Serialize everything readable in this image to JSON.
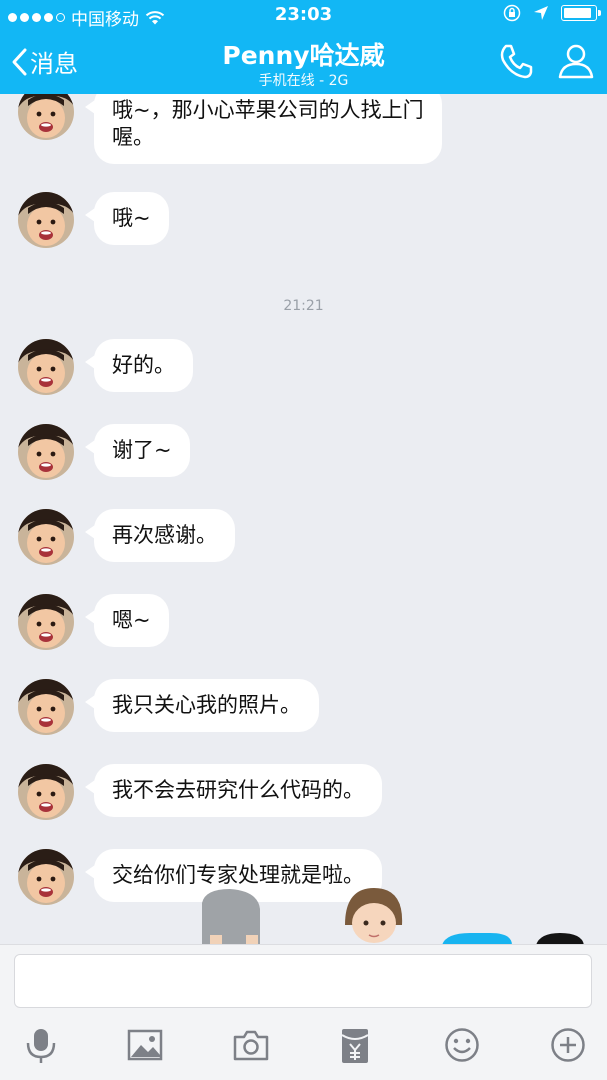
{
  "status_bar": {
    "carrier": "中国移动",
    "time": "23:03",
    "signal_dots": 4,
    "battery_level": 0.9
  },
  "nav": {
    "back_label": "消息",
    "title": "Penny哈达威",
    "subtitle": "手机在线 - 2G",
    "phone_icon": "phone-icon",
    "profile_icon": "person-icon"
  },
  "conversation": {
    "timestamp": "21:21",
    "messages": [
      {
        "lines": [
          "哦~，那小心苹果公司的人找上门",
          "喔。"
        ]
      },
      {
        "lines": [
          "哦~"
        ]
      },
      {
        "lines": [
          "好的。"
        ]
      },
      {
        "lines": [
          "谢了~"
        ]
      },
      {
        "lines": [
          "再次感谢。"
        ]
      },
      {
        "lines": [
          "嗯~"
        ]
      },
      {
        "lines": [
          "我只关心我的照片。"
        ]
      },
      {
        "lines": [
          "我不会去研究什么代码的。"
        ]
      },
      {
        "lines": [
          "交给你们专家处理就是啦。"
        ]
      }
    ]
  },
  "input": {
    "placeholder": ""
  },
  "toolbar": {
    "items": [
      "microphone-icon",
      "image-icon",
      "camera-icon",
      "red-packet-icon",
      "emoji-icon",
      "plus-icon"
    ]
  },
  "colors": {
    "brand": "#12b7f5",
    "background": "#ebedf2",
    "bubble": "#ffffff"
  }
}
